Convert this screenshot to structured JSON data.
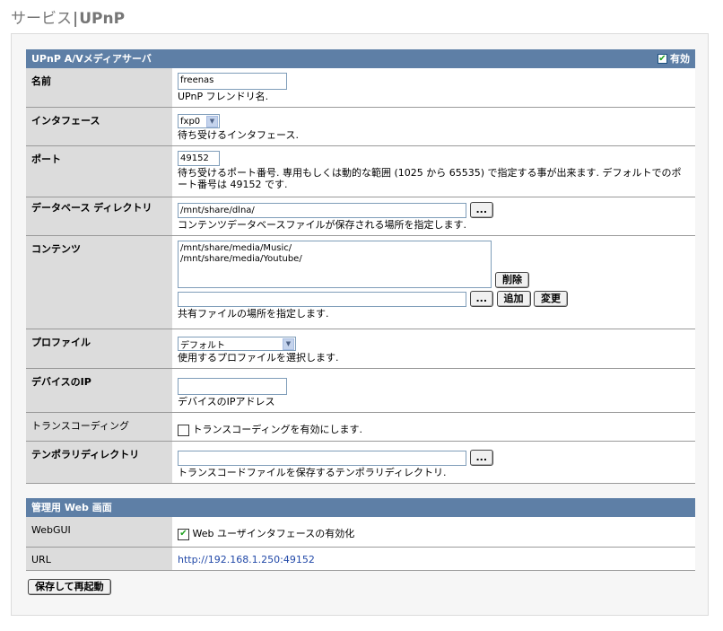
{
  "header": {
    "section": "サービス",
    "separator": "|",
    "current": "UPnP"
  },
  "upnp": {
    "title": "UPnP A/Vメディアサーバ",
    "enable_label": "有効",
    "enable_checked": true,
    "name": {
      "label": "名前",
      "value": "freenas",
      "desc": "UPnP フレンドリ名."
    },
    "interface": {
      "label": "インタフェース",
      "value": "fxp0",
      "desc": "待ち受けるインタフェース."
    },
    "port": {
      "label": "ポート",
      "value": "49152",
      "desc": "待ち受けるポート番号. 専用もしくは動的な範囲 (1025 から 65535) で指定する事が出来ます. デフォルトでのポート番号は 49152 です."
    },
    "database": {
      "label": "データベース ディレクトリ",
      "value": "/mnt/share/dlna/",
      "browse": "...",
      "desc": "コンテンツデータベースファイルが保存される場所を指定します."
    },
    "content": {
      "label": "コンテンツ",
      "items": [
        "/mnt/share/media/Music/",
        "/mnt/share/media/Youtube/"
      ],
      "delete_button": "削除",
      "browse": "...",
      "add_button": "追加",
      "change_button": "変更",
      "desc": "共有ファイルの場所を指定します."
    },
    "profile": {
      "label": "プロファイル",
      "value": "デフォルト",
      "desc": "使用するプロファイルを選択します."
    },
    "device_ip": {
      "label": "デバイスのIP",
      "value": "",
      "desc": "デバイスのIPアドレス"
    },
    "transcoding": {
      "label": "トランスコーディング",
      "checkbox_label": "トランスコーディングを有効にします.",
      "checked": false
    },
    "temp_dir": {
      "label": "テンポラリディレクトリ",
      "value": "",
      "browse": "...",
      "desc": "トランスコードファイルを保存するテンポラリディレクトリ."
    }
  },
  "web": {
    "title": "管理用 Web 画面",
    "webgui": {
      "label": "WebGUI",
      "checkbox_label": "Web ユーザインタフェースの有効化",
      "checked": true
    },
    "url": {
      "label": "URL",
      "value": "http://192.168.1.250:49152"
    }
  },
  "save_button": "保存して再起動"
}
